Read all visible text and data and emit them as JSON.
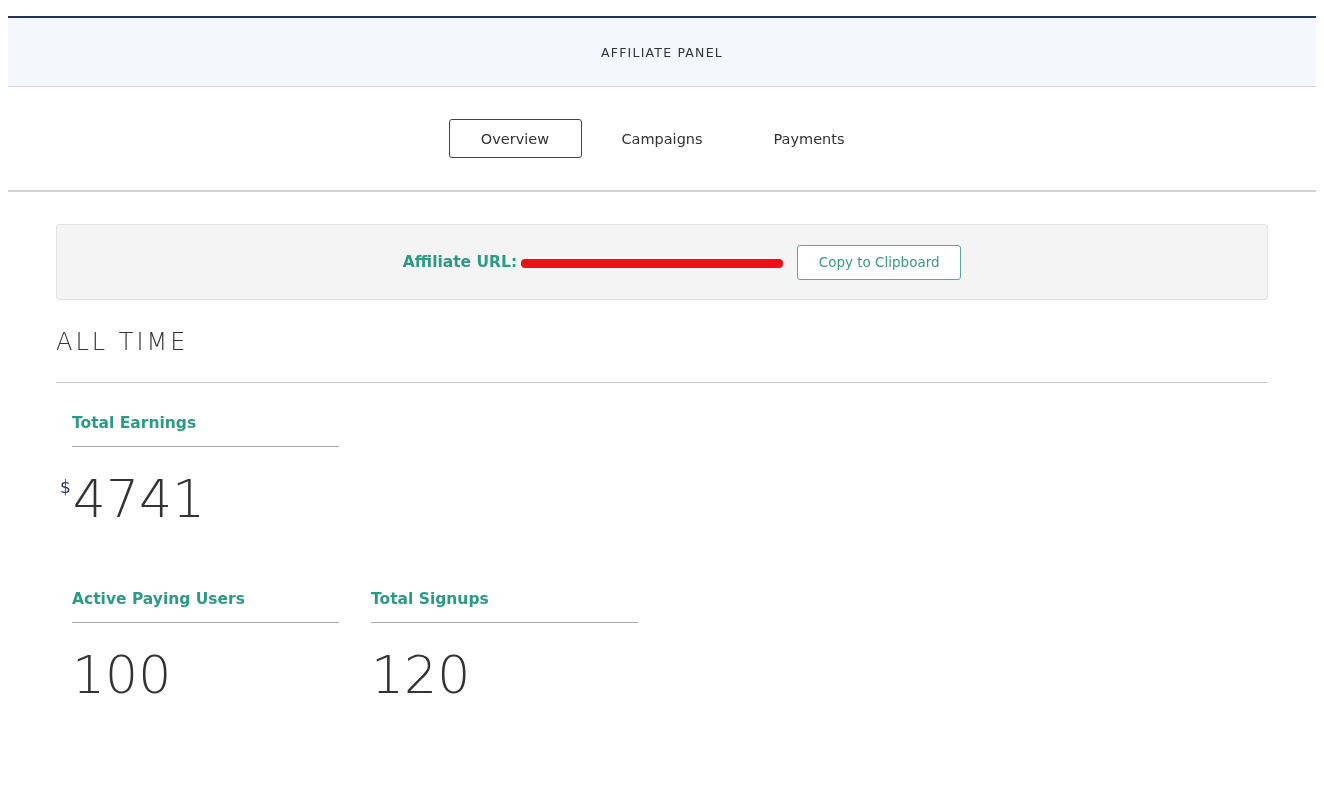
{
  "header": {
    "title": "AFFILIATE PANEL"
  },
  "tabs": [
    {
      "label": "Overview",
      "selected": true
    },
    {
      "label": "Campaigns",
      "selected": false
    },
    {
      "label": "Payments",
      "selected": false
    }
  ],
  "affiliate_url": {
    "label": "Affiliate URL:",
    "redacted": true,
    "button": "Copy to Clipboard"
  },
  "section_title": "ALL TIME",
  "stat_rows": [
    [
      {
        "label": "Total Earnings",
        "currency": "$",
        "value": "4741"
      }
    ],
    [
      {
        "label": "Active Paying Users",
        "value": "100"
      },
      {
        "label": "Total Signups",
        "value": "120"
      }
    ]
  ]
}
